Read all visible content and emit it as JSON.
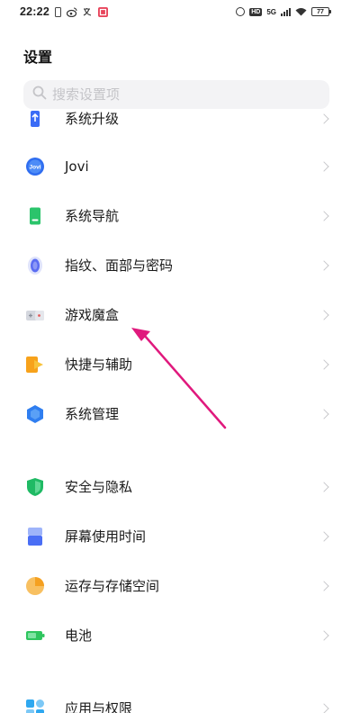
{
  "status_bar": {
    "time": "22:22",
    "icons": [
      "phone-icon",
      "weibo-icon",
      "translate-icon",
      "app-badge-icon"
    ],
    "right_icons": [
      "alarm-icon",
      "hd-icon",
      "5g-signal-icon",
      "wifi-icon",
      "battery-icon"
    ],
    "hd": "HD",
    "network": "5G",
    "battery": "77"
  },
  "page": {
    "title": "设置"
  },
  "search": {
    "placeholder": "搜索设置项",
    "value": ""
  },
  "settings": {
    "items": [
      {
        "label": "系统升级",
        "icon": "system-update-icon",
        "color": "#3b6cf6"
      },
      {
        "label": "Jovi",
        "icon": "jovi-icon",
        "color": "#2f6df0"
      },
      {
        "label": "系统导航",
        "icon": "navigation-icon",
        "color": "#2bc46b"
      },
      {
        "label": "指纹、面部与密码",
        "icon": "fingerprint-icon",
        "color": "#5b6df2"
      },
      {
        "label": "游戏魔盒",
        "icon": "game-box-icon",
        "color": "#b9bcc6"
      },
      {
        "label": "快捷与辅助",
        "icon": "shortcut-icon",
        "color": "#f7a21b"
      },
      {
        "label": "系统管理",
        "icon": "system-manage-icon",
        "color": "#2f7ef0"
      },
      {
        "label": "安全与隐私",
        "icon": "shield-icon",
        "color": "#1fba64"
      },
      {
        "label": "屏幕使用时间",
        "icon": "screen-time-icon",
        "color": "#4a6ef5"
      },
      {
        "label": "运存与存储空间",
        "icon": "storage-icon",
        "color": "#f5a020"
      },
      {
        "label": "电池",
        "icon": "battery-setting-icon",
        "color": "#2ec55e"
      },
      {
        "label": "应用与权限",
        "icon": "apps-icon",
        "color": "#2fa8f0"
      }
    ]
  },
  "annotation": {
    "arrow_color": "#e0197d"
  }
}
